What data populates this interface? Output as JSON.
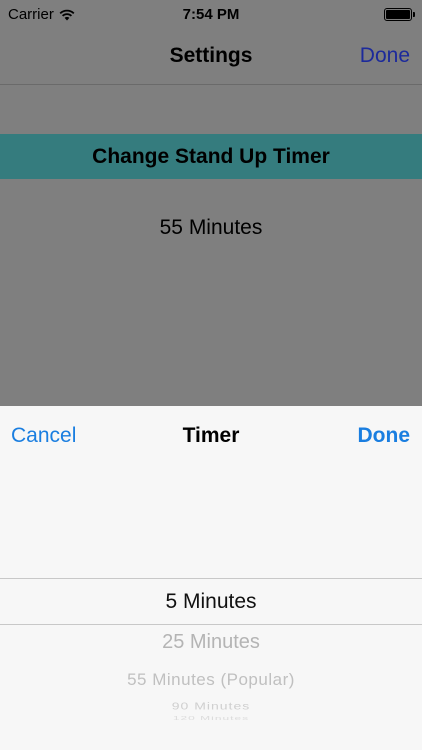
{
  "status_bar": {
    "carrier": "Carrier",
    "time": "7:54 PM",
    "wifi_icon": "wifi-icon",
    "battery_icon": "battery-icon",
    "battery_level": 1.0
  },
  "nav": {
    "title": "Settings",
    "done_label": "Done"
  },
  "banner": {
    "label": "Change Stand Up Timer"
  },
  "current_timer": "55 Minutes",
  "picker_sheet": {
    "cancel_label": "Cancel",
    "title": "Timer",
    "done_label": "Done",
    "options": [
      "5 Minutes",
      "25 Minutes",
      "55 Minutes (Popular)",
      "90 Minutes",
      "120 Minutes"
    ],
    "selected": "5 Minutes"
  },
  "colors": {
    "banner": "#357c7e",
    "accent": "#1a7ee0",
    "nav_done": "#1c2a9b",
    "overlay_background": "#7f7f7f",
    "sheet_background": "#f7f7f7"
  }
}
